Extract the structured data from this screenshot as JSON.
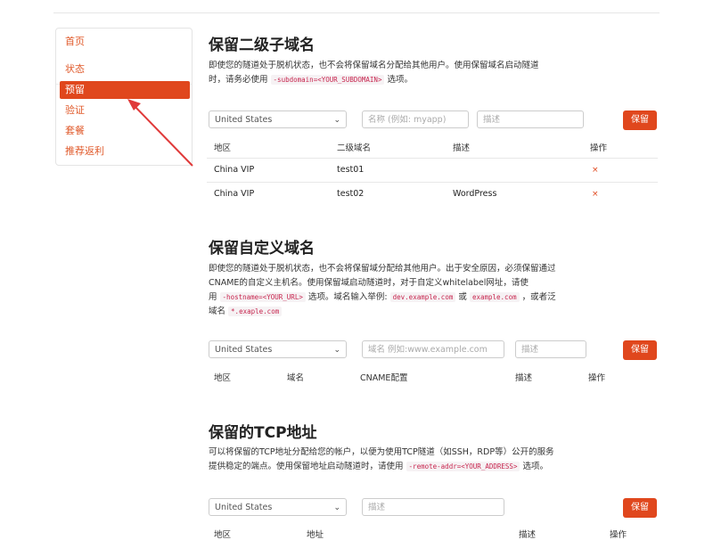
{
  "sidebar": {
    "items": [
      {
        "label": "首页"
      },
      {
        "label": "状态"
      },
      {
        "label": "预留"
      },
      {
        "label": "验证"
      },
      {
        "label": "套餐"
      },
      {
        "label": "推荐返利"
      }
    ],
    "active_index": 2
  },
  "subdomain": {
    "title": "保留二级子域名",
    "desc_1": "即使您的隧道处于脱机状态，也不会将保留域名分配给其他用户。使用保留域名启动隧道",
    "desc_2a": "时，请务必使用",
    "desc_code": "-subdomain=<YOUR_SUBDOMAIN>",
    "desc_2b": "选项。",
    "region_value": "United States",
    "name_placeholder": "名称 (例如: myapp)",
    "desc_placeholder": "描述",
    "reserve_button": "保留",
    "headers": [
      "地区",
      "二级域名",
      "描述",
      "操作"
    ],
    "rows": [
      {
        "region": "China VIP",
        "subdomain": "test01",
        "desc": "",
        "action": "×"
      },
      {
        "region": "China VIP",
        "subdomain": "test02",
        "desc": "WordPress",
        "action": "×"
      }
    ]
  },
  "custom": {
    "title": "保留自定义域名",
    "desc_1": "即使您的隧道处于脱机状态，也不会将保留域分配给其他用户。出于安全原因，必须保留通过",
    "desc_2": "CNAME的自定义主机名。使用保留域启动隧道时，对于自定义whitelabel网址，请使",
    "desc_3a": "用",
    "desc_code1": "-hostname=<YOUR_URL>",
    "desc_3b": "选项。域名输入举例:",
    "desc_code2": "dev.example.com",
    "desc_3c": "或",
    "desc_code3": "example.com",
    "desc_3d": "，或者泛",
    "desc_4a": "域名",
    "desc_code4": "*.exaple.com",
    "region_value": "United States",
    "domain_placeholder": "域名 例如:www.example.com",
    "desc_placeholder": "描述",
    "reserve_button": "保留",
    "headers": [
      "地区",
      "域名",
      "CNAME配置",
      "描述",
      "操作"
    ]
  },
  "tcp": {
    "title": "保留的TCP地址",
    "desc_1": "可以将保留的TCP地址分配给您的帐户，以便为使用TCP隧道（如SSH，RDP等）公开的服务",
    "desc_2a": "提供稳定的端点。使用保留地址启动隧道时，请使用",
    "desc_code": "-remote-addr=<YOUR_ADDRESS>",
    "desc_2b": "选项。",
    "region_value": "United States",
    "desc_placeholder": "描述",
    "reserve_button": "保留",
    "headers": [
      "地区",
      "地址",
      "描述",
      "操作"
    ]
  },
  "colors": {
    "accent": "#e0471d",
    "annotation_arrow": "#e03a3a"
  }
}
